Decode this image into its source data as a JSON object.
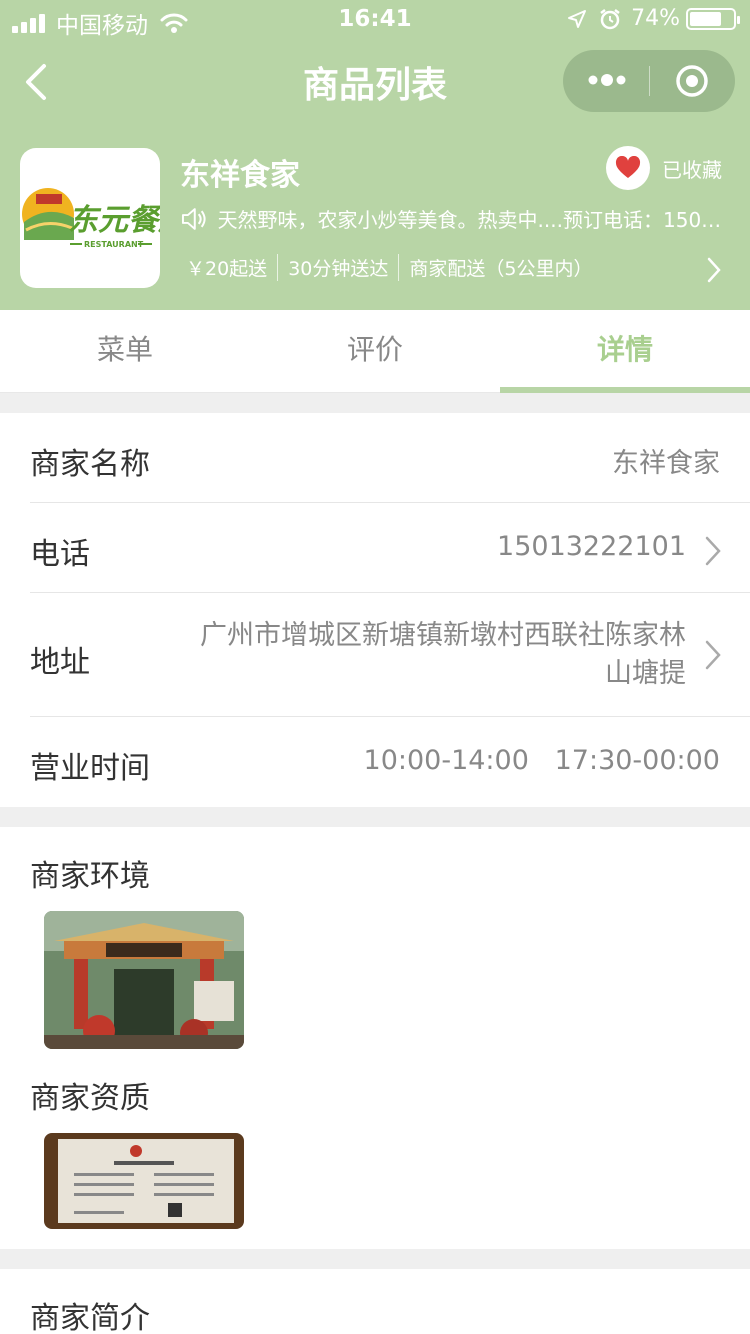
{
  "status_bar": {
    "carrier": "中国移动",
    "time": "16:41",
    "battery": "74%",
    "battery_level": 0.74
  },
  "nav": {
    "title": "商品列表"
  },
  "shop": {
    "name": "东祥食家",
    "favorite_label": "已收藏",
    "notice": "天然野味，农家小炒等美食。热卖中....预订电话：1501...",
    "min_order": "￥20起送",
    "delivery_time": "30分钟送达",
    "delivery_mode": "商家配送（5公里内）",
    "logo_text": "东元餐厅",
    "logo_sub": "RESTAURANT"
  },
  "tabs": [
    {
      "label": "菜单"
    },
    {
      "label": "评价"
    },
    {
      "label": "详情"
    }
  ],
  "details": {
    "name_label": "商家名称",
    "name_value": "东祥食家",
    "phone_label": "电话",
    "phone_value": "15013222101",
    "address_label": "地址",
    "address_line1": "广州市增城区新塘镇新墩村西联社陈家林",
    "address_line2": "山塘提",
    "hours_label": "营业时间",
    "hours_value": "10:00-14:00   17:30-00:00"
  },
  "sections": {
    "environment": "商家环境",
    "qualification": "商家资质",
    "intro": "商家简介"
  },
  "colors": {
    "header_bg": "#b8d5a6",
    "active_tab": "#a9cf8f",
    "heart": "#e0413e"
  }
}
